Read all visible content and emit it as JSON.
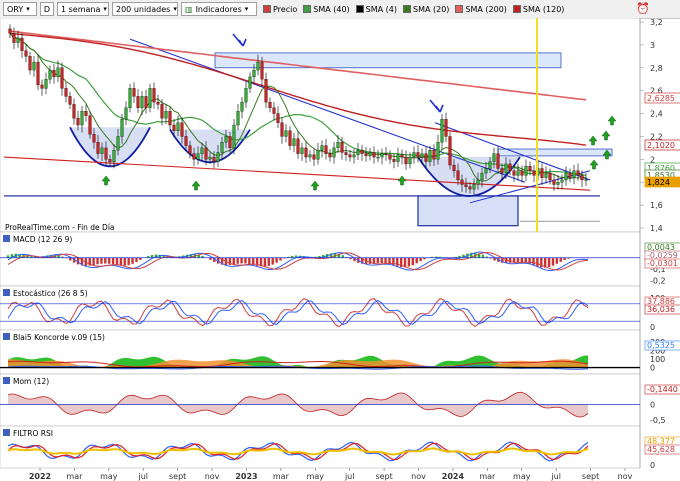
{
  "toolbar": {
    "symbol": "ORY",
    "mode": "D",
    "period": "1 semana",
    "units": "200 unidades",
    "indicators": "Indicadores",
    "legend": [
      {
        "label": "Precio",
        "color": "#d04040"
      },
      {
        "label": "SMA (40)",
        "color": "#40a040"
      },
      {
        "label": "SMA (4)",
        "color": "#000000"
      },
      {
        "label": "SMA (20)",
        "color": "#3a7a20"
      },
      {
        "label": "SMA (200)",
        "color": "#e06060"
      },
      {
        "label": "SMA (120)",
        "color": "#c02020"
      }
    ]
  },
  "source_label": "ProRealTime.com - Fin de Día",
  "chart_data": [
    {
      "type": "candlestick",
      "name": "ORY",
      "ylim": [
        1.4,
        3.2
      ],
      "yticks": [
        "3,2",
        "3",
        "2,8",
        "2,6",
        "2,4",
        "2,2",
        "2",
        "1,8",
        "1,6",
        "1,4"
      ],
      "last_values": [
        {
          "value": "2,6285",
          "color": "#d04040",
          "kind": "sma200"
        },
        {
          "value": "2,1020",
          "color": "#c02020",
          "kind": "sma120"
        },
        {
          "value": "1,8760",
          "color": "#40a040",
          "kind": "sma40"
        },
        {
          "value": "1,8530",
          "color": "#3a7a20",
          "kind": "sma20"
        },
        {
          "value": "1,824",
          "color": "#e8a000",
          "kind": "price"
        }
      ],
      "weekly_close": [
        3.1,
        3.02,
        3.06,
        2.95,
        2.9,
        2.78,
        2.85,
        2.65,
        2.62,
        2.7,
        2.78,
        2.72,
        2.8,
        2.62,
        2.55,
        2.48,
        2.36,
        2.3,
        2.42,
        2.38,
        2.22,
        2.15,
        2.05,
        2.1,
        2.0,
        1.98,
        2.08,
        2.2,
        2.35,
        2.45,
        2.62,
        2.55,
        2.45,
        2.55,
        2.45,
        2.62,
        2.5,
        2.48,
        2.36,
        2.42,
        2.3,
        2.25,
        2.32,
        2.2,
        2.12,
        2.05,
        2.0,
        2.05,
        2.1,
        2.0,
        2.02,
        1.98,
        2.06,
        2.15,
        2.2,
        2.1,
        2.3,
        2.42,
        2.5,
        2.62,
        2.72,
        2.78,
        2.85,
        2.7,
        2.5,
        2.45,
        2.4,
        2.32,
        2.2,
        2.25,
        2.12,
        2.18,
        2.05,
        2.1,
        2.02,
        2.04,
        2.0,
        2.08,
        2.12,
        2.05,
        2.02,
        2.1,
        2.15,
        2.06,
        2.04,
        2.02,
        2.04,
        2.08,
        2.05,
        2.03,
        2.06,
        2.02,
        2.02,
        2.05,
        2.04,
        2.0,
        1.98,
        2.04,
        2.02,
        1.96,
        2.02,
        2.06,
        2.02,
        2.05,
        1.98,
        2.08,
        2.0,
        2.15,
        2.35,
        2.2,
        1.95,
        1.9,
        1.82,
        1.78,
        1.76,
        1.74,
        1.78,
        1.82,
        1.88,
        1.92,
        1.98,
        2.05,
        1.92,
        1.88,
        1.96,
        1.9,
        1.86,
        1.9,
        1.86,
        1.94,
        1.9,
        1.86,
        1.92,
        1.84,
        1.88,
        1.82,
        1.78,
        1.8,
        1.82,
        1.88,
        1.84,
        1.9,
        1.86,
        1.82,
        1.824
      ],
      "sma200": [
        3.12,
        2.52
      ],
      "sma120": [
        3.1,
        2.06
      ],
      "annotations": {
        "yellow_vline_label": "",
        "zones": [
          "resistance-box-2023",
          "support-box-2024"
        ]
      }
    },
    {
      "type": "line",
      "name": "MACD (12 26 9)",
      "yticks": [
        "0,1",
        "0",
        "-0,1",
        "-0,2"
      ],
      "ylim": [
        -0.22,
        0.12
      ],
      "last_values": [
        {
          "value": "0,0043",
          "color": "#3a7a20"
        },
        {
          "value": "-0,0259",
          "color": "#b06070"
        },
        {
          "value": "-0,0301",
          "color": "#d04040"
        }
      ]
    },
    {
      "type": "line",
      "name": "Estocástico (26 8 5)",
      "yticks": [
        "100",
        "0"
      ],
      "ylim": [
        0,
        100
      ],
      "last_values": [
        {
          "value": "37,886",
          "color": "#d04040"
        },
        {
          "value": "36,036",
          "color": "#c02020"
        }
      ]
    },
    {
      "type": "area",
      "name": "Blai5 Koncorde v.09 (15)",
      "yticks": [
        "300",
        "200",
        "100",
        "0"
      ],
      "ylim": [
        -40,
        300
      ],
      "last_values": [
        {
          "value": "0,5325",
          "color": "#3080ff"
        }
      ]
    },
    {
      "type": "line",
      "name": "Mom (12)",
      "yticks": [
        "0,5",
        "0",
        "-0,5"
      ],
      "ylim": [
        -0.6,
        0.6
      ],
      "last_values": [
        {
          "value": "-0,1440",
          "color": "#c02020"
        }
      ]
    },
    {
      "type": "line",
      "name": "FILTRO RSI",
      "yticks": [
        "50",
        "0"
      ],
      "ylim": [
        0,
        100
      ],
      "last_values": [
        {
          "value": "48,377",
          "color": "#e8a000"
        },
        {
          "value": "45,628",
          "color": "#d04040"
        }
      ]
    }
  ],
  "xaxis": {
    "ticks": [
      "2022",
      "mar",
      "may",
      "jul",
      "sept",
      "nov",
      "2023",
      "mar",
      "may",
      "jul",
      "sept",
      "nov",
      "2024",
      "mar",
      "may",
      "jul",
      "sept",
      "nov"
    ],
    "bold": [
      "2022",
      "2023",
      "2024"
    ]
  }
}
